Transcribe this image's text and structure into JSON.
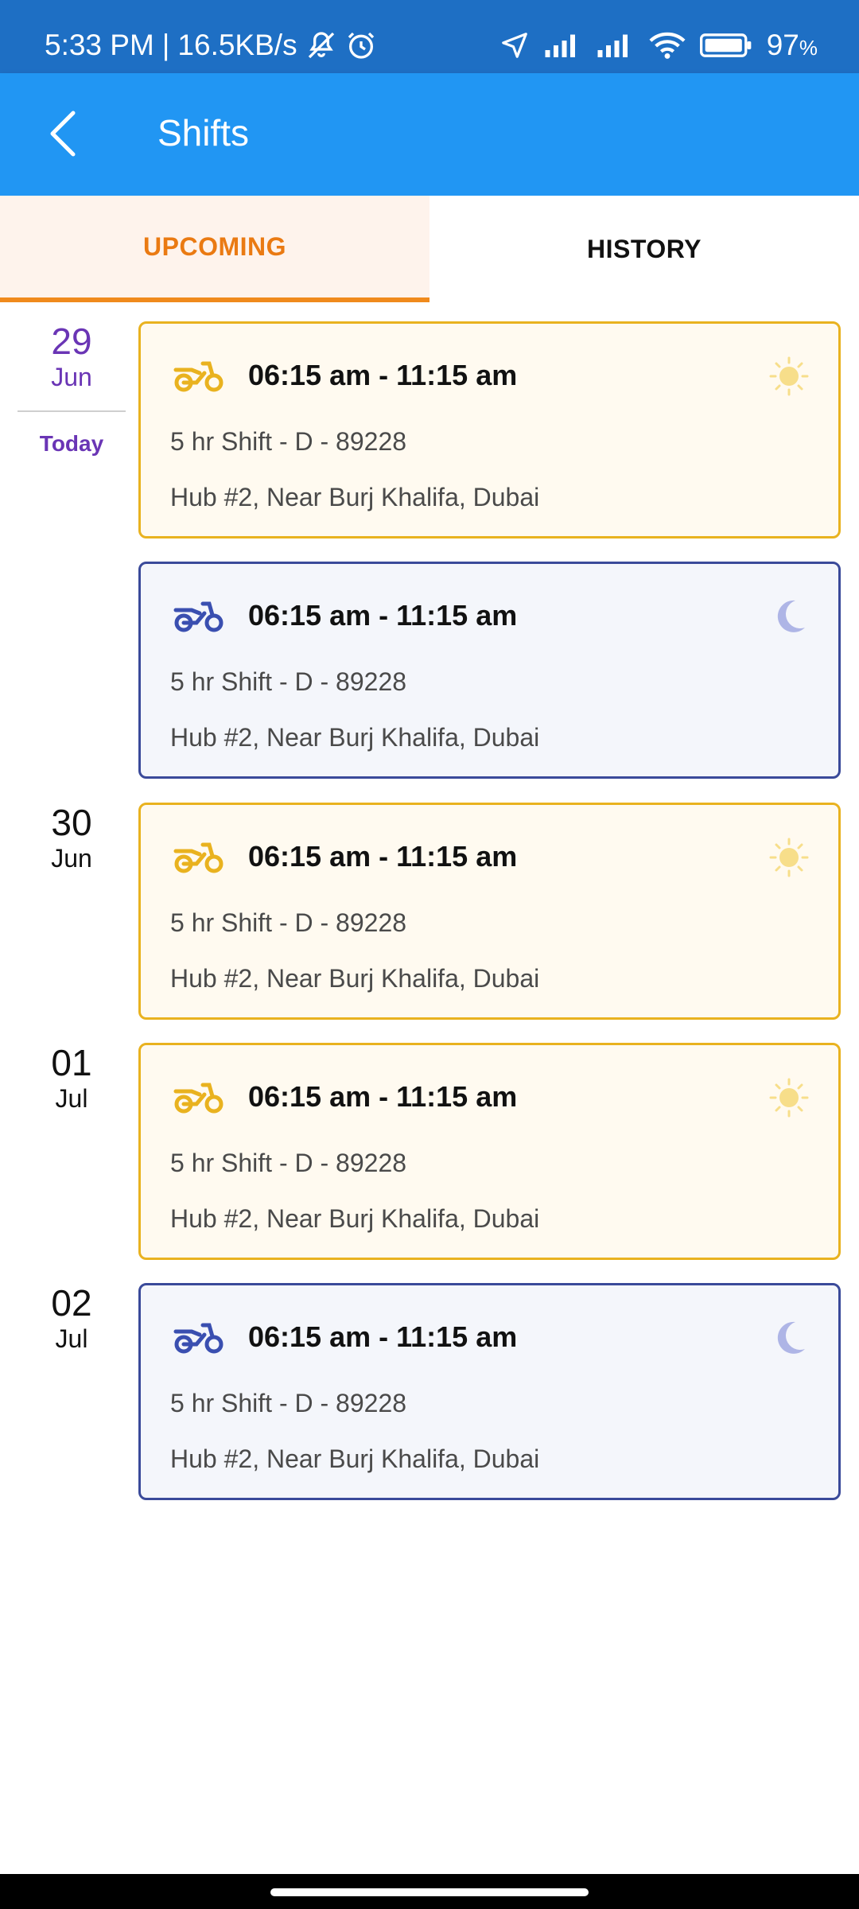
{
  "status_bar": {
    "time": "5:33 PM",
    "separator": "|",
    "speed": "16.5KB/s",
    "battery": "97",
    "battery_unit": "%",
    "icons": [
      "mute-icon",
      "alarm-icon",
      "location-icon",
      "signal-icon",
      "signal-icon",
      "wifi-icon",
      "battery-icon"
    ]
  },
  "app_bar": {
    "title": "Shifts",
    "back_icon": "back-arrow-icon",
    "color": "#2196F3"
  },
  "tabs": [
    {
      "label": "UPCOMING",
      "active": true,
      "color": "#EA7A12"
    },
    {
      "label": "HISTORY",
      "active": false
    }
  ],
  "groups": [
    {
      "day": "29",
      "month": "Jun",
      "today_label": "Today",
      "is_today": true,
      "shifts": [
        {
          "time": "06:15 am - 11:15 am",
          "title": "5 hr Shift - D - 89228",
          "location": "Hub #2, Near Burj Khalifa, Dubai",
          "period": "day",
          "period_icon": "sun-icon",
          "vehicle_icon": "motorbike-icon"
        },
        {
          "time": "06:15 am - 11:15 am",
          "title": "5 hr Shift - D - 89228",
          "location": "Hub #2, Near Burj Khalifa, Dubai",
          "period": "night",
          "period_icon": "moon-icon",
          "vehicle_icon": "motorbike-icon"
        }
      ]
    },
    {
      "day": "30",
      "month": "Jun",
      "shifts": [
        {
          "time": "06:15 am - 11:15 am",
          "title": "5 hr Shift - D - 89228",
          "location": "Hub #2, Near Burj Khalifa, Dubai",
          "period": "day",
          "period_icon": "sun-icon",
          "vehicle_icon": "motorbike-icon"
        }
      ]
    },
    {
      "day": "01",
      "month": "Jul",
      "shifts": [
        {
          "time": "06:15 am - 11:15 am",
          "title": "5 hr Shift - D - 89228",
          "location": "Hub #2, Near Burj Khalifa, Dubai",
          "period": "day",
          "period_icon": "sun-icon",
          "vehicle_icon": "motorbike-icon"
        }
      ]
    },
    {
      "day": "02",
      "month": "Jul",
      "shifts": [
        {
          "time": "06:15 am - 11:15 am",
          "title": "5 hr Shift - D - 89228",
          "location": "Hub #2, Near Burj Khalifa, Dubai",
          "period": "night",
          "period_icon": "moon-icon",
          "vehicle_icon": "motorbike-icon"
        }
      ]
    }
  ],
  "colors": {
    "today_accent": "#6A35B5",
    "day_border": "#E9B21F",
    "day_bg": "#FFFAF0",
    "night_border": "#3A4A9A",
    "night_bg": "#F4F6FB",
    "day_bike": "#E9B21F",
    "night_bike": "#3A4FB0",
    "sun": "#F7DE8A",
    "moon": "#AEB5E6"
  }
}
